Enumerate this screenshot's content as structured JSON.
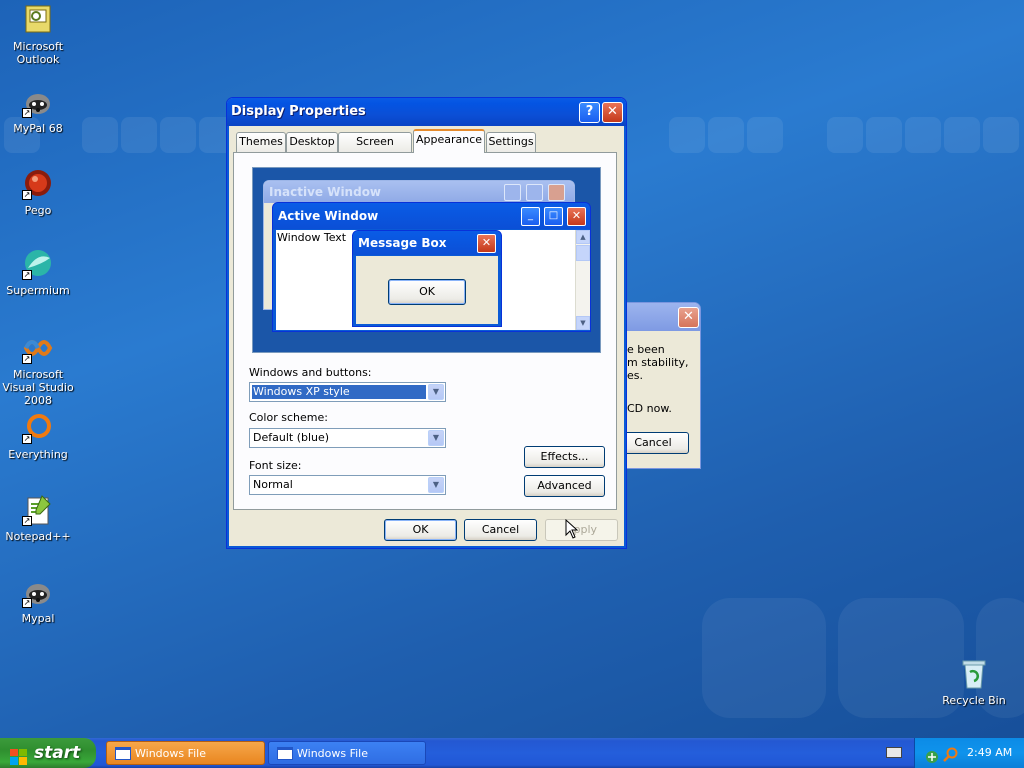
{
  "desktop": {
    "icons": [
      {
        "label": "Microsoft Outlook"
      },
      {
        "label": "MyPal 68"
      },
      {
        "label": "Pego"
      },
      {
        "label": "Supermium"
      },
      {
        "label": "Microsoft Visual Studio 2008"
      },
      {
        "label": "Everything"
      },
      {
        "label": "Notepad++"
      },
      {
        "label": "Mypal"
      },
      {
        "label": "Recycle Bin"
      }
    ]
  },
  "display_properties": {
    "title": "Display Properties",
    "tabs": [
      "Themes",
      "Desktop",
      "Screen Saver",
      "Appearance",
      "Settings"
    ],
    "active_tab": "Appearance",
    "preview": {
      "inactive_title": "Inactive Window",
      "active_title": "Active Window",
      "window_text": "Window Text",
      "message_title": "Message Box",
      "message_ok": "OK"
    },
    "windows_buttons_label": "Windows and buttons:",
    "windows_buttons_value": "Windows XP style",
    "color_scheme_label": "Color scheme:",
    "color_scheme_value": "Default (blue)",
    "font_size_label": "Font size:",
    "font_size_value": "Normal",
    "effects_button": "Effects...",
    "advanced_button": "Advanced",
    "ok_button": "OK",
    "cancel_button": "Cancel",
    "apply_button": "Apply"
  },
  "background_dialog": {
    "line1": "e been",
    "line2": "m stability,",
    "line3": "es.",
    "line4": "CD now.",
    "cancel_button": "Cancel"
  },
  "taskbar": {
    "start_label": "start",
    "tasks": [
      {
        "label": "Windows File Protection",
        "active": true
      },
      {
        "label": "Windows File Protection",
        "active": false
      }
    ],
    "clock": "2:49 AM"
  },
  "colors": {
    "title_blue": "#0a5ce6",
    "close_red": "#c4381a",
    "tab_accent": "#e68b2c",
    "start_green": "#2f8f2f"
  }
}
